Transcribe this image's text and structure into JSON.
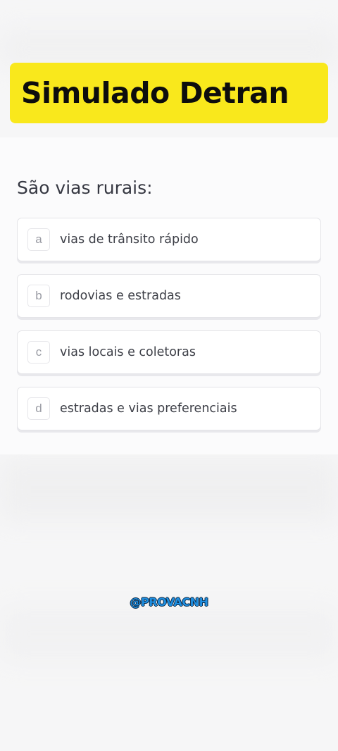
{
  "header": {
    "title": "Simulado Detran"
  },
  "quiz": {
    "question": "São vias rurais:",
    "options": [
      {
        "letter": "a",
        "text": "vias de trânsito rápido"
      },
      {
        "letter": "b",
        "text": "rodovias e estradas"
      },
      {
        "letter": "c",
        "text": "vias locais e coletoras"
      },
      {
        "letter": "d",
        "text": "estradas e vias preferenciais"
      }
    ]
  },
  "watermark": {
    "handle": "@PROVACNH"
  },
  "colors": {
    "title_background": "#f9e81c",
    "handle_color": "#1e8ee0"
  }
}
